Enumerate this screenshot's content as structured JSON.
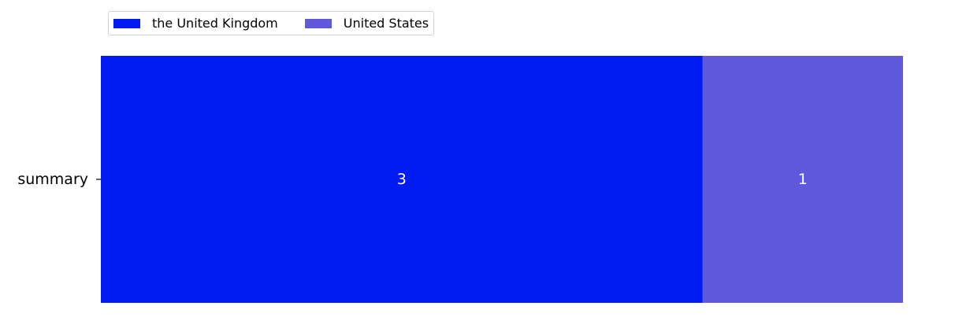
{
  "chart_data": {
    "type": "bar",
    "orientation": "horizontal",
    "stacked": true,
    "categories": [
      "summary"
    ],
    "series": [
      {
        "name": "the United Kingdom",
        "values": [
          3
        ],
        "color": "#001cf0"
      },
      {
        "name": "United States",
        "values": [
          1
        ],
        "color": "#6059db"
      }
    ],
    "xlim": [
      0,
      4
    ],
    "title": "",
    "xlabel": "",
    "ylabel": "",
    "grid": false,
    "legend": {
      "position": "top-left",
      "columns": 2
    },
    "data_labels": true,
    "data_label_color": "#ffffff"
  }
}
